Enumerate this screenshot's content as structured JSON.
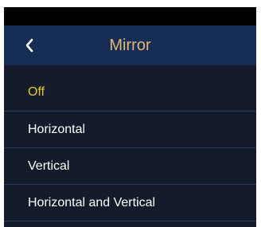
{
  "header": {
    "title": "Mirror",
    "back_icon": "chevron-left-icon"
  },
  "options": [
    {
      "label": "Off",
      "selected": true
    },
    {
      "label": "Horizontal",
      "selected": false
    },
    {
      "label": "Vertical",
      "selected": false
    },
    {
      "label": "Horizontal and Vertical",
      "selected": false
    }
  ],
  "colors": {
    "header_bg": "#162d55",
    "body_bg": "#141c2b",
    "title": "#e2b776",
    "selected": "#e7c72c",
    "text": "#ffffff",
    "divider": "#2a3b5c"
  }
}
